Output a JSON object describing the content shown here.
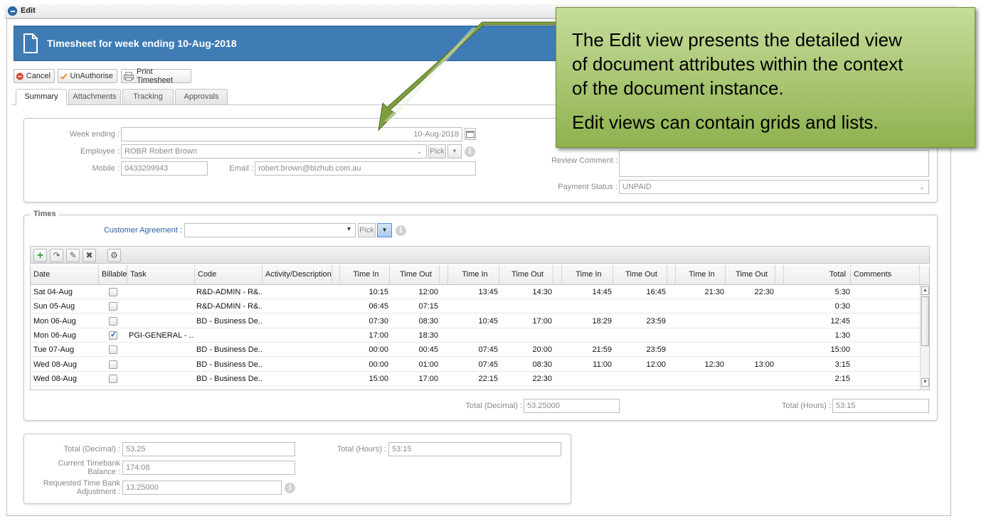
{
  "window": {
    "title": "Edit"
  },
  "header": {
    "title": "Timesheet for week ending 10-Aug-2018"
  },
  "toolbar": {
    "cancel": "Cancel",
    "unauthorise": "UnAuthorise",
    "print": "Print Timesheet"
  },
  "tabs": [
    "Summary",
    "Attachments",
    "Tracking",
    "Approvals"
  ],
  "summary": {
    "week_ending_label": "Week ending :",
    "week_ending_value": "10-Aug-2018",
    "employee_label": "Employee :",
    "employee_value": "ROBR Robert Brown",
    "pick_label": "Pick",
    "mobile_label": "Mobile :",
    "mobile_value": "0433209943",
    "email_label": "Email :",
    "email_value": "robert.brown@bizhub.com.au",
    "review_comment_label": "Review Comment :",
    "review_comment_value": "",
    "payment_status_label": "Payment Status :",
    "payment_status_value": "UNPAID"
  },
  "times": {
    "legend": "Times",
    "customer_agreement_label": "Customer Agreement :",
    "customer_agreement_value": "",
    "pick_label": "Pick",
    "columns": [
      "Date",
      "Billable",
      "Task",
      "Code",
      "Activity/Description",
      "Time In",
      "Time Out",
      "Time In",
      "Time Out",
      "Time In",
      "Time Out",
      "Time In",
      "Time Out",
      "Total",
      "Comments"
    ],
    "rows": [
      {
        "date": "Sat 04-Aug",
        "billable": false,
        "task": "",
        "code": "R&D-ADMIN - R&...",
        "activity": "",
        "t": [
          "10:15",
          "12:00",
          "13:45",
          "14:30",
          "14:45",
          "16:45",
          "21:30",
          "22:30"
        ],
        "total": "5:30",
        "comments": ""
      },
      {
        "date": "Sun 05-Aug",
        "billable": false,
        "task": "",
        "code": "R&D-ADMIN - R&...",
        "activity": "",
        "t": [
          "06:45",
          "07:15",
          "",
          "",
          "",
          "",
          "",
          ""
        ],
        "total": "0:30",
        "comments": ""
      },
      {
        "date": "Mon 06-Aug",
        "billable": false,
        "task": "",
        "code": "BD - Business De...",
        "activity": "",
        "t": [
          "07:30",
          "08:30",
          "10:45",
          "17:00",
          "18:29",
          "23:59",
          "",
          ""
        ],
        "total": "12:45",
        "comments": ""
      },
      {
        "date": "Mon 06-Aug",
        "billable": true,
        "task": "PGI-GENERAL - ...",
        "code": "",
        "activity": "",
        "t": [
          "17:00",
          "18:30",
          "",
          "",
          "",
          "",
          "",
          ""
        ],
        "total": "1:30",
        "comments": ""
      },
      {
        "date": "Tue 07-Aug",
        "billable": false,
        "task": "",
        "code": "BD - Business De...",
        "activity": "",
        "t": [
          "00:00",
          "00:45",
          "07:45",
          "20:00",
          "21:59",
          "23:59",
          "",
          ""
        ],
        "total": "15:00",
        "comments": ""
      },
      {
        "date": "Wed 08-Aug",
        "billable": false,
        "task": "",
        "code": "BD - Business De...",
        "activity": "",
        "t": [
          "00:00",
          "01:00",
          "07:45",
          "08:30",
          "11:00",
          "12:00",
          "12:30",
          "13:00"
        ],
        "total": "3:15",
        "comments": ""
      },
      {
        "date": "Wed 08-Aug",
        "billable": false,
        "task": "",
        "code": "BD - Business De...",
        "activity": "",
        "t": [
          "15:00",
          "17:00",
          "22:15",
          "22:30",
          "",
          "",
          "",
          ""
        ],
        "total": "2:15",
        "comments": ""
      }
    ],
    "total_decimal_label": "Total (Decimal) :",
    "total_decimal_value": "53.25000",
    "total_hours_label": "Total (Hours) :",
    "total_hours_value": "53:15"
  },
  "totals": {
    "total_decimal_label": "Total (Decimal) :",
    "total_decimal_value": "53.25",
    "total_hours_label": "Total (Hours) :",
    "total_hours_value": "53:15",
    "timebank_label_1": "Current Timebank",
    "timebank_label_2": "Balance :",
    "timebank_value": "174:08",
    "adjust_label_1": "Requested Time Bank",
    "adjust_label_2": "Adjustment :",
    "adjust_value": "13.25000"
  },
  "callout": {
    "line1": "The Edit view presents the detailed view",
    "line2": "of document attributes within the context",
    "line3": "of the document instance.",
    "line4": "Edit views can contain grids and lists."
  },
  "colors": {
    "header": "#3f7cb5",
    "callout": "#9bbb59",
    "add": "#3aa335",
    "cancel": "#d9462d",
    "tick": "#f08a24"
  },
  "icons": {
    "window": "edit-circle-icon",
    "header": "document-icon",
    "cancel": "stop-icon",
    "unauthorise": "checkmark-icon",
    "print": "printer-icon",
    "calendar": "calendar-icon",
    "info": "info-icon"
  }
}
